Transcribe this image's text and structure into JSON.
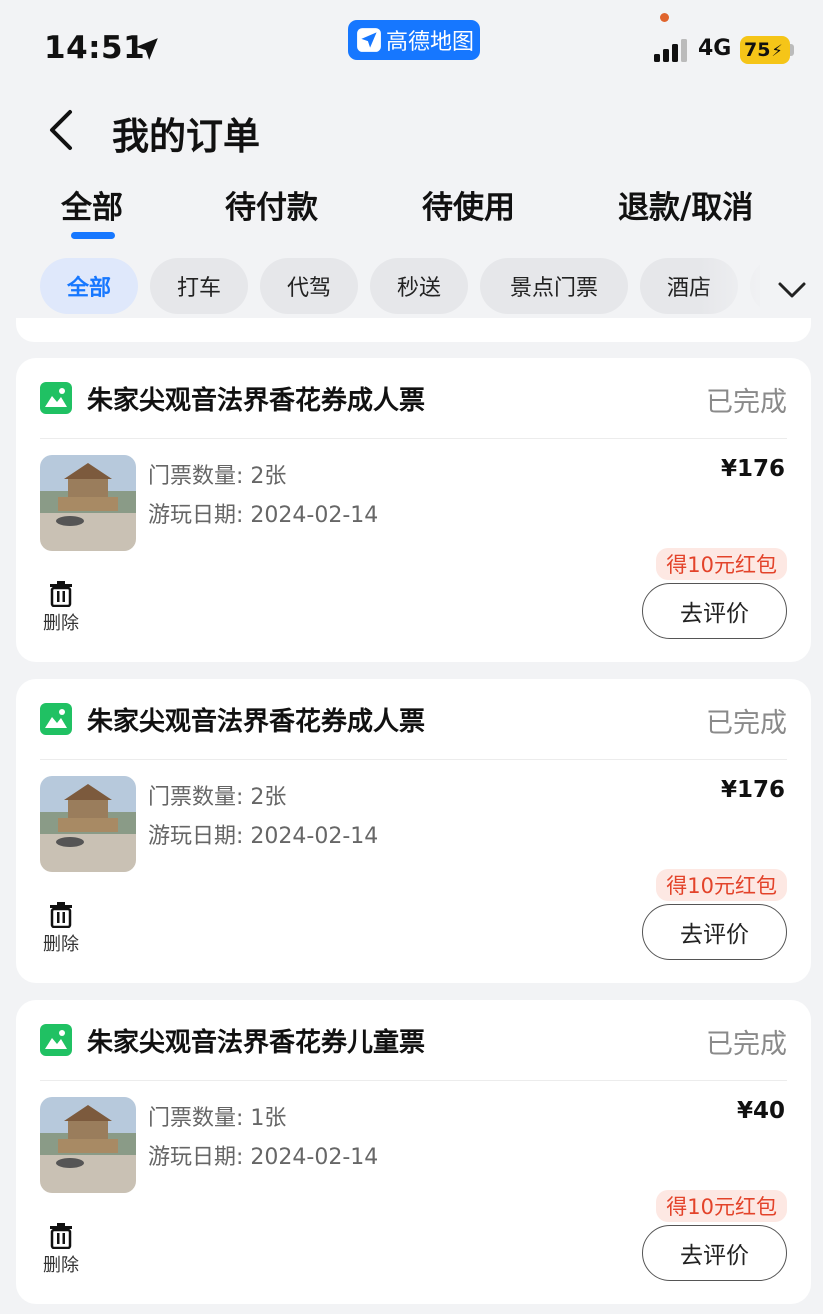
{
  "status_bar": {
    "time": "14:51",
    "app_name": "高德地图",
    "network": "4G",
    "battery": "75"
  },
  "header": {
    "title": "我的订单"
  },
  "tabs": [
    {
      "label": "全部",
      "active": true
    },
    {
      "label": "待付款"
    },
    {
      "label": "待使用"
    },
    {
      "label": "退款/取消"
    }
  ],
  "filters": [
    {
      "label": "全部",
      "active": true
    },
    {
      "label": "打车"
    },
    {
      "label": "代驾"
    },
    {
      "label": "秒送"
    },
    {
      "label": "景点门票"
    },
    {
      "label": "酒店"
    }
  ],
  "orders": [
    {
      "title": "朱家尖观音法界香花券成人票",
      "status": "已完成",
      "quantity": "门票数量: 2张",
      "date": "游玩日期: 2024-02-14",
      "price": "¥176",
      "promo": "得10元红包",
      "delete_label": "删除",
      "review_label": "去评价"
    },
    {
      "title": "朱家尖观音法界香花券成人票",
      "status": "已完成",
      "quantity": "门票数量: 2张",
      "date": "游玩日期: 2024-02-14",
      "price": "¥176",
      "promo": "得10元红包",
      "delete_label": "删除",
      "review_label": "去评价"
    },
    {
      "title": "朱家尖观音法界香花券儿童票",
      "status": "已完成",
      "quantity": "门票数量: 1张",
      "date": "游玩日期: 2024-02-14",
      "price": "¥40",
      "promo": "得10元红包",
      "delete_label": "删除",
      "review_label": "去评价"
    }
  ],
  "colors": {
    "accent": "#1677ff",
    "promo_text": "#e3432a",
    "promo_bg": "#fde8e3",
    "ticket_icon": "#20c163",
    "battery": "#f5c518"
  }
}
